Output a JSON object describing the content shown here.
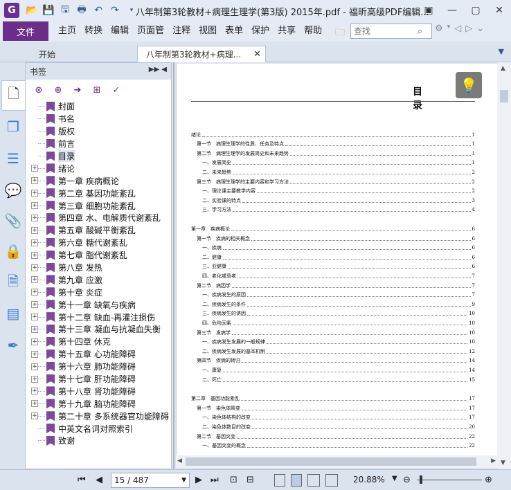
{
  "app": {
    "icon_letter": "G",
    "title": "八年制第3轮教材+病理生理学(第3版) 2015年.pdf - 福昕高级PDF编辑..."
  },
  "menu": {
    "file": "文件",
    "items": [
      "主页",
      "转换",
      "编辑",
      "页面管",
      "注释",
      "视图",
      "表单",
      "保护",
      "共享",
      "帮助"
    ],
    "search_placeholder": "查找"
  },
  "tabs": {
    "start": "开始",
    "doc": "八年制第3轮教材+病理..."
  },
  "bookmarks": {
    "header": "书签",
    "items": [
      {
        "label": "封面",
        "expandable": false
      },
      {
        "label": "书名",
        "expandable": false
      },
      {
        "label": "版权",
        "expandable": false
      },
      {
        "label": "前言",
        "expandable": false
      },
      {
        "label": "目录",
        "expandable": false,
        "selected": true
      },
      {
        "label": "绪论",
        "expandable": true
      },
      {
        "label": "第一章 疾病概论",
        "expandable": true
      },
      {
        "label": "第二章 基因功能紊乱",
        "expandable": true
      },
      {
        "label": "第三章 细胞功能紊乱",
        "expandable": true
      },
      {
        "label": "第四章 水、电解质代谢紊乱",
        "expandable": true
      },
      {
        "label": "第五章 酸碱平衡紊乱",
        "expandable": true
      },
      {
        "label": "第六章 糖代谢紊乱",
        "expandable": true
      },
      {
        "label": "第七章 脂代谢紊乱",
        "expandable": true
      },
      {
        "label": "第八章 发热",
        "expandable": true
      },
      {
        "label": "第九章 应激",
        "expandable": true
      },
      {
        "label": "第十章 炎症",
        "expandable": true
      },
      {
        "label": "第十一章 缺氧与疾病",
        "expandable": true
      },
      {
        "label": "第十二章 缺血-再灌注损伤",
        "expandable": true
      },
      {
        "label": "第十三章 凝血与抗凝血失衡",
        "expandable": true
      },
      {
        "label": "第十四章 休克",
        "expandable": true
      },
      {
        "label": "第十五章 心功能障碍",
        "expandable": true
      },
      {
        "label": "第十六章 肺功能障碍",
        "expandable": true
      },
      {
        "label": "第十七章 肝功能障碍",
        "expandable": true
      },
      {
        "label": "第十八章 肾功能障碍",
        "expandable": true
      },
      {
        "label": "第十九章 脑功能障碍",
        "expandable": true
      },
      {
        "label": "第二十章 多系统器官功能障碍",
        "expandable": true
      },
      {
        "label": "中英文名词对照索引",
        "expandable": false
      },
      {
        "label": "致谢",
        "expandable": false
      }
    ]
  },
  "document": {
    "heading": "目 录",
    "toc": [
      {
        "level": 0,
        "text": "绪论",
        "page": "1",
        "gap": 1
      },
      {
        "level": 1,
        "text": "第一节　病理生理学的性质、任务及特点",
        "page": "1"
      },
      {
        "level": 1,
        "text": "第二节　病理生理学的发展简史和未来趋势",
        "page": "1"
      },
      {
        "level": 2,
        "text": "一、发展简史",
        "page": "1"
      },
      {
        "level": 2,
        "text": "二、未来趋势",
        "page": "2"
      },
      {
        "level": 1,
        "text": "第三节　病理生理学的主要内容和学习方法",
        "page": "2"
      },
      {
        "level": 2,
        "text": "一、理论课主要教学内容",
        "page": "2"
      },
      {
        "level": 2,
        "text": "二、实验课的特点",
        "page": "3"
      },
      {
        "level": 2,
        "text": "三、学习方法",
        "page": "4"
      },
      {
        "level": 0,
        "text": "第一章　疾病概论",
        "page": "6",
        "gap": 1
      },
      {
        "level": 1,
        "text": "第一节　疾病的相关概念",
        "page": "6"
      },
      {
        "level": 2,
        "text": "一、疾病",
        "page": "6"
      },
      {
        "level": 2,
        "text": "二、健康",
        "page": "6"
      },
      {
        "level": 2,
        "text": "三、亚健康",
        "page": "6"
      },
      {
        "level": 2,
        "text": "四、老化或衰老",
        "page": "7"
      },
      {
        "level": 1,
        "text": "第二节　病因学",
        "page": "7"
      },
      {
        "level": 2,
        "text": "一、疾病发生的原因",
        "page": "7"
      },
      {
        "level": 2,
        "text": "二、疾病发生的条件",
        "page": "9"
      },
      {
        "level": 2,
        "text": "三、疾病发生的诱因",
        "page": "10"
      },
      {
        "level": 2,
        "text": "四、危险因素",
        "page": "10"
      },
      {
        "level": 1,
        "text": "第三节　发病学",
        "page": "10"
      },
      {
        "level": 2,
        "text": "一、疾病发生发展的一般规律",
        "page": "10"
      },
      {
        "level": 2,
        "text": "二、疾病发生发展的基本机制",
        "page": "12"
      },
      {
        "level": 1,
        "text": "第四节　疾病的转归",
        "page": "14"
      },
      {
        "level": 2,
        "text": "一、康复",
        "page": "14"
      },
      {
        "level": 2,
        "text": "二、死亡",
        "page": "15"
      },
      {
        "level": 0,
        "text": "第二章　基因功能紊乱",
        "page": "17",
        "gap": 1
      },
      {
        "level": 1,
        "text": "第一节　染色体畸变",
        "page": "17"
      },
      {
        "level": 2,
        "text": "一、染色体结构的改变",
        "page": "17"
      },
      {
        "level": 2,
        "text": "二、染色体数目的改变",
        "page": "20"
      },
      {
        "level": 1,
        "text": "第二节　基因突变",
        "page": "22"
      },
      {
        "level": 2,
        "text": "一、基因突变的概念",
        "page": "22"
      }
    ]
  },
  "status": {
    "page_input": "15 / 487",
    "zoom": "20.88%"
  }
}
